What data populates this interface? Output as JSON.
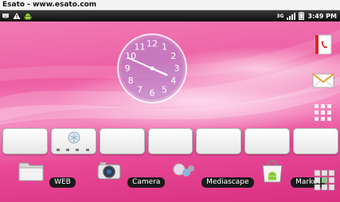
{
  "banner": {
    "title": "Esato - www.esato.com"
  },
  "status_bar": {
    "network": "3G",
    "time": "3:49 PM",
    "icons": [
      "notification-icon",
      "warning-icon",
      "android-debug-icon",
      "signal-icon",
      "battery-icon"
    ]
  },
  "clock_widget": {
    "numbers": [
      "12",
      "1",
      "2",
      "3",
      "4",
      "5",
      "6",
      "7",
      "8",
      "9",
      "10",
      "11"
    ],
    "hour_hand_hours": 3.8,
    "minute_hand_minutes": 49
  },
  "side_shortcuts": [
    "phone-book-icon",
    "messaging-envelope-icon",
    "app-grid-icon"
  ],
  "dock_slots_count": 7,
  "apps": [
    {
      "label": "WEB",
      "icon": "folder-icon"
    },
    {
      "label": "Camera",
      "icon": "camera-icon"
    },
    {
      "label": "Mediascape",
      "icon": "mediascape-icon"
    },
    {
      "label": "Market",
      "icon": "market-bag-icon"
    }
  ],
  "colors": {
    "wallpaper": "#ee5fa4",
    "status_bar": "#111111",
    "label_bg": "#1a1a1a"
  }
}
